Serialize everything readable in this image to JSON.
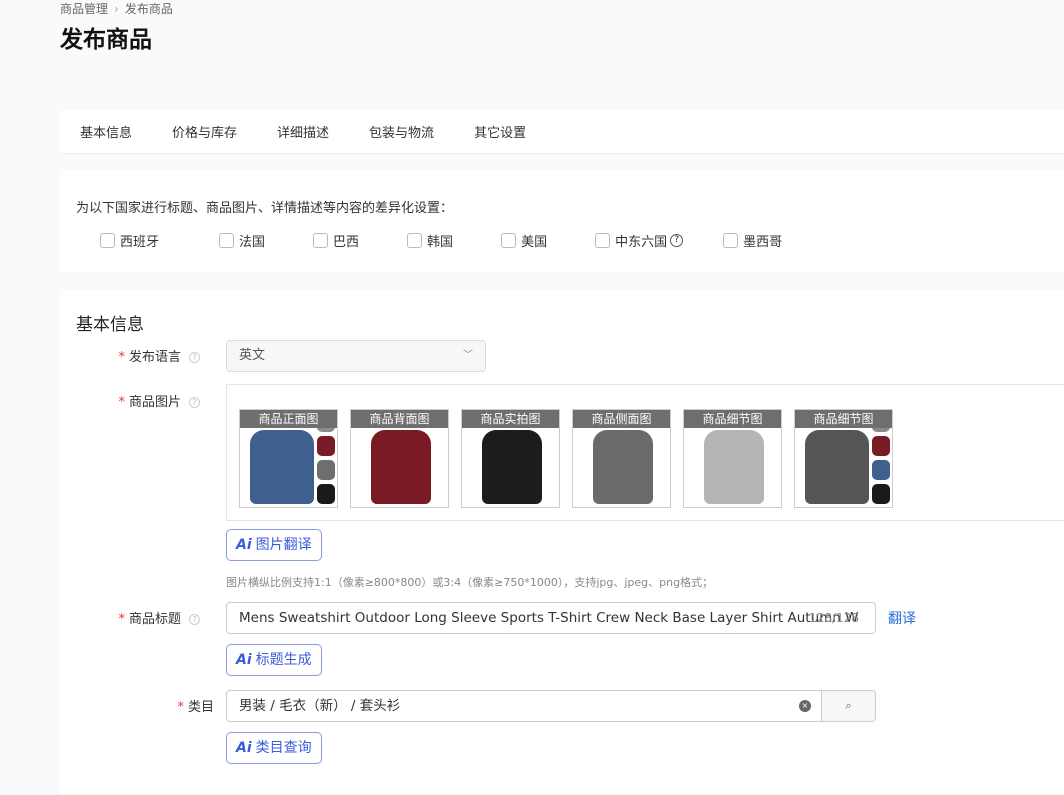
{
  "breadcrumb": {
    "parent": "商品管理",
    "current": "发布商品"
  },
  "page_title": "发布商品",
  "tabs": [
    "基本信息",
    "价格与库存",
    "详细描述",
    "包装与物流",
    "其它设置"
  ],
  "countries": {
    "title": "为以下国家进行标题、商品图片、详情描述等内容的差异化设置：",
    "options": [
      "西班牙",
      "法国",
      "巴西",
      "韩国",
      "美国",
      "中东六国",
      "墨西哥"
    ]
  },
  "basic": {
    "section_title": "基本信息",
    "language": {
      "label": "发布语言",
      "value": "英文"
    },
    "images": {
      "label": "商品图片",
      "items": [
        {
          "label": "商品正面图",
          "color": "#3f5f8f",
          "variants": [
            "#8a8a8a",
            "#7a1a24",
            "#6e6e6e",
            "#1a1a1a"
          ]
        },
        {
          "label": "商品背面图",
          "color": "#7a1a24"
        },
        {
          "label": "商品实拍图",
          "color": "#1c1c1c"
        },
        {
          "label": "商品侧面图",
          "color": "#6a6a6a"
        },
        {
          "label": "商品细节图",
          "color": "#b5b5b8"
        },
        {
          "label": "商品细节图",
          "color": "#555558",
          "variants": [
            "#8a8a8a",
            "#7a1a24",
            "#3f5f8f",
            "#1a1a1a"
          ]
        }
      ],
      "ai_button": "图片翻译",
      "hint": "图片横纵比例支持1:1（像素≥800*800）或3:4（像素≥750*1000），支持jpg、jpeg、png格式；"
    },
    "title": {
      "label": "商品标题",
      "value": "Mens Sweatshirt Outdoor Long Sleeve Sports T-Shirt Crew Neck Base Layer Shirt Autumn W",
      "count": "128/128",
      "translate": "翻译",
      "ai_button": "标题生成"
    },
    "category": {
      "label": "类目",
      "value": "男装 / 毛衣（新） / 套头衫",
      "ai_button": "类目查询"
    }
  },
  "accent": "#3b5bdb"
}
